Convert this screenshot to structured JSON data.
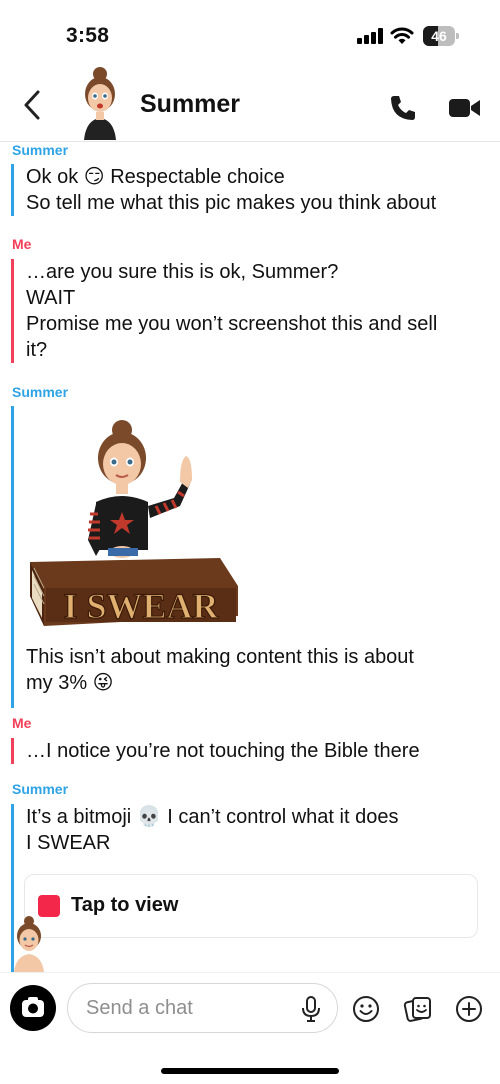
{
  "status_bar": {
    "time": "3:58",
    "battery_level": "46",
    "battery_fraction": 0.46,
    "icons": [
      "signal-icon",
      "wifi-icon",
      "battery-icon"
    ]
  },
  "header": {
    "title": "Summer",
    "icons": [
      "back-chevron-icon",
      "bitmoji-avatar",
      "phone-icon",
      "video-camera-icon"
    ]
  },
  "colors": {
    "friend": "#2ea4e6",
    "me": "#f2405a",
    "snap_red": "#f2274a"
  },
  "messages": [
    {
      "sender": "Summer",
      "lines": [
        "Ok ok 😏 Respectable choice",
        "So tell me what this pic makes you think about"
      ]
    },
    {
      "sender": "Me",
      "lines": [
        "…are you sure this is ok, Summer?",
        "WAIT",
        "Promise me you won’t screenshot this and sell",
        "it?"
      ]
    },
    {
      "sender": "Summer",
      "bitmoji_text": "I SWEAR",
      "lines": [
        "This isn’t about making content this is about",
        "my 3% 😜"
      ]
    },
    {
      "sender": "Me",
      "lines": [
        "…I notice you’re not touching the Bible there"
      ]
    },
    {
      "sender": "Summer",
      "lines": [
        "It’s a bitmoji 💀 I can’t control what it does",
        "I SWEAR"
      ],
      "attachment": {
        "label": "Tap to view"
      }
    }
  ],
  "composer": {
    "placeholder": "Send a chat",
    "icons": [
      "camera-icon",
      "microphone-icon",
      "smiley-icon",
      "sticker-icon",
      "plus-icon"
    ]
  }
}
